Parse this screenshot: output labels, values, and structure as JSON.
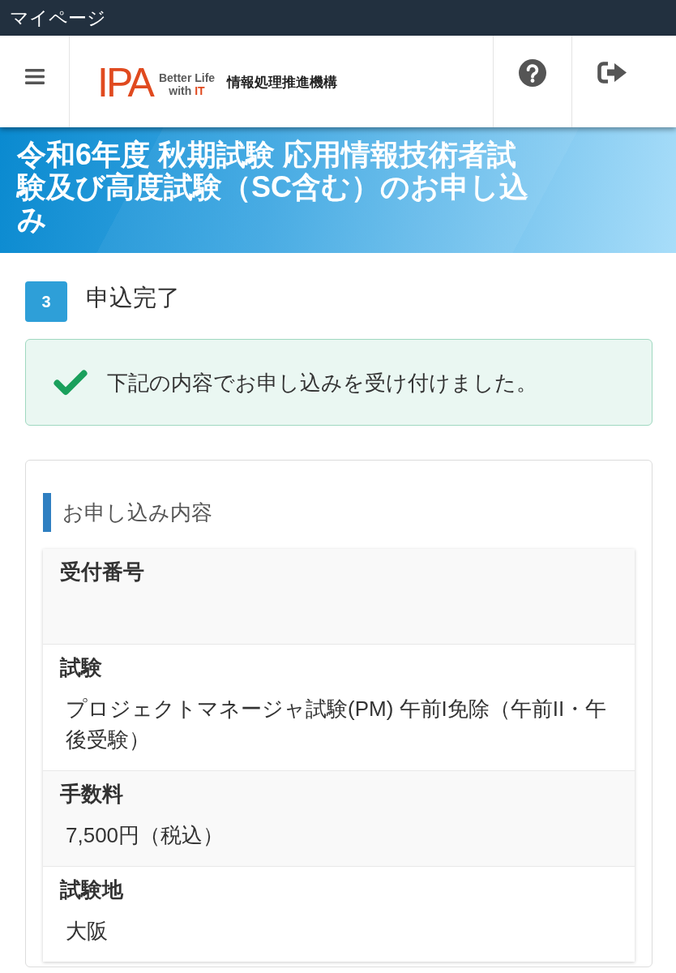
{
  "top_bar": {
    "title": "マイページ"
  },
  "header": {
    "logo": {
      "mark": "IPA",
      "tagline": [
        "Better Life",
        "with **IT**"
      ],
      "org_name": "情報処理推進機構"
    }
  },
  "banner": {
    "title": "令和6年度 秋期試験 応用情報技術者試験及び高度試験（SC含む）のお申し込み"
  },
  "step": {
    "number": "3",
    "title": "申込完了"
  },
  "alert": {
    "kind": "success",
    "message": "下記の内容でお申し込みを受け付けました。"
  },
  "details": {
    "heading": "お申し込み内容",
    "rows": [
      {
        "label": "受付番号"
      },
      {
        "label": "試験",
        "value": "プロジェクトマネージャ試験(PM) 午前I免除（午前II・午後受験）"
      },
      {
        "label": "手数料",
        "value": "7,500円（税込）"
      },
      {
        "label": "試験地",
        "value": "大阪"
      }
    ]
  }
}
